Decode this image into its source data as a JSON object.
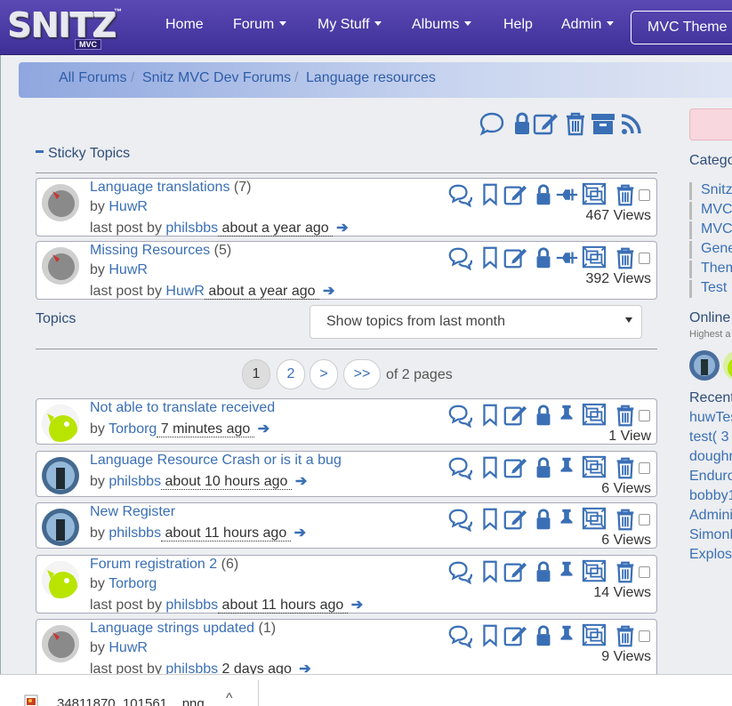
{
  "navbar": {
    "logo_text": "SNITZ",
    "logo_tm": "™",
    "logo_sub": "MVC",
    "items": [
      {
        "label": "Home",
        "dropdown": false
      },
      {
        "label": "Forum",
        "dropdown": true
      },
      {
        "label": "My Stuff",
        "dropdown": true
      },
      {
        "label": "Albums",
        "dropdown": true
      },
      {
        "label": "Help",
        "dropdown": false
      },
      {
        "label": "Admin",
        "dropdown": true
      }
    ],
    "theme_button": "MVC Theme"
  },
  "breadcrumb": [
    "All Forums",
    "Snitz MVC Dev Forums",
    "Language resources"
  ],
  "toolbar_icons": [
    "chat-icon",
    "lock-icon",
    "edit-icon",
    "trash-icon",
    "archive-icon",
    "rss-icon"
  ],
  "sticky": {
    "heading": "Sticky Topics",
    "topics": [
      {
        "title": "Language translations",
        "count": "(7)",
        "by": "by",
        "author": "HuwR",
        "lastpost_prefix": "last post",
        "lastpost_by": "by",
        "lastpost_user": "philsbbs",
        "time": " about a year ago ",
        "views": "467 Views"
      },
      {
        "title": "Missing Resources",
        "count": "(5)",
        "by": "by",
        "author": "HuwR",
        "lastpost_prefix": "last post",
        "lastpost_by": "by",
        "lastpost_user": "HuwR",
        "time": " about a year ago ",
        "views": "392 Views"
      }
    ]
  },
  "topics_label": "Topics",
  "filter_select": "Show topics from last month",
  "pagination": {
    "pages": [
      "1",
      "2",
      ">",
      ">>"
    ],
    "current": "1",
    "summary": "of 2 pages"
  },
  "topics": [
    {
      "title": "Not able to translate received",
      "count": "",
      "by": "by",
      "author": "Torborg",
      "time": " 7 minutes ago ",
      "views": "1 View",
      "has_lastpost": false
    },
    {
      "title": "Language Resource Crash or is it a bug",
      "count": "",
      "by": "by",
      "author": "philsbbs",
      "time": " about 10 hours ago ",
      "views": "6 Views",
      "has_lastpost": false
    },
    {
      "title": "New Register",
      "count": "",
      "by": "by",
      "author": "philsbbs",
      "time": " about 11 hours ago ",
      "views": "6 Views",
      "has_lastpost": false
    },
    {
      "title": "Forum registration 2",
      "count": "(6)",
      "by": "by",
      "author": "Torborg",
      "lastpost_prefix": "last post",
      "lastpost_by": "by",
      "lastpost_user": "philsbbs",
      "time": " about 11 hours ago ",
      "views": "14 Views",
      "has_lastpost": true
    },
    {
      "title": "Language strings updated",
      "count": "(1)",
      "by": "by",
      "author": "HuwR",
      "lastpost_prefix": "last post",
      "lastpost_by": "by",
      "lastpost_user": "philsbbs",
      "time": " 2 days ago ",
      "views": "9 Views",
      "has_lastpost": true
    }
  ],
  "sidebar": {
    "categories_title": "Catego",
    "categories": [
      "Snitz",
      "MVC",
      "MVC",
      "Gene",
      "Them",
      "Test"
    ],
    "online_title": "Online",
    "online_sub": "Highest a",
    "recent_title": "Recent",
    "recent_users": [
      "huwTes",
      "test( 3",
      "doughr",
      "Enduro",
      "bobby1",
      "Admini",
      "SimonE",
      "Explos"
    ]
  },
  "download": {
    "filename": "34811870_101561....png",
    "caret": "^"
  },
  "colors": {
    "navbar": "#4a3aa8",
    "accent": "#3a6fb5",
    "page_bg": "#eceef1"
  }
}
